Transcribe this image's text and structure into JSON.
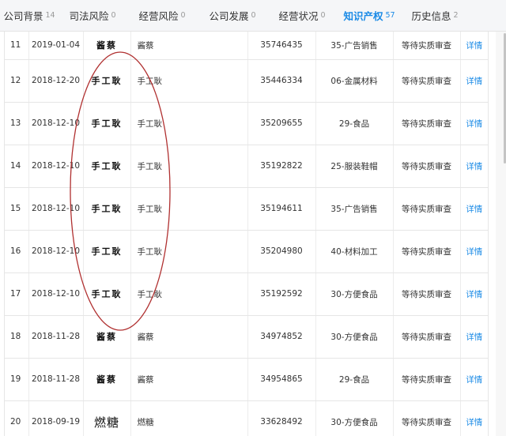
{
  "tabs": [
    {
      "label": "公司背景",
      "count": "14",
      "active": false,
      "w": 74
    },
    {
      "label": "司法风险",
      "count": "0",
      "active": false,
      "w": 86
    },
    {
      "label": "经营风险",
      "count": "0",
      "active": false,
      "w": 90
    },
    {
      "label": "公司发展",
      "count": "0",
      "active": false,
      "w": 88
    },
    {
      "label": "经营状况",
      "count": "0",
      "active": false,
      "w": 88
    },
    {
      "label": "知识产权",
      "count": "57",
      "active": true,
      "w": 82
    },
    {
      "label": "历史信息",
      "count": "2",
      "active": false,
      "w": 84
    }
  ],
  "rows": [
    {
      "no": "11",
      "date": "2019-01-04",
      "logo": "酱蔡",
      "name": "酱蔡",
      "reg": "35746435",
      "cls": "35-广告销售",
      "status": "等待实质审查",
      "detail": "详情"
    },
    {
      "no": "12",
      "date": "2018-12-20",
      "logo": "手工耿",
      "name": "手工耿",
      "reg": "35446334",
      "cls": "06-金属材料",
      "status": "等待实质审查",
      "detail": "详情"
    },
    {
      "no": "13",
      "date": "2018-12-10",
      "logo": "手工耿",
      "name": "手工耿",
      "reg": "35209655",
      "cls": "29-食品",
      "status": "等待实质审查",
      "detail": "详情"
    },
    {
      "no": "14",
      "date": "2018-12-10",
      "logo": "手工耿",
      "name": "手工耿",
      "reg": "35192822",
      "cls": "25-服装鞋帽",
      "status": "等待实质审查",
      "detail": "详情"
    },
    {
      "no": "15",
      "date": "2018-12-10",
      "logo": "手工耿",
      "name": "手工耿",
      "reg": "35194611",
      "cls": "35-广告销售",
      "status": "等待实质审查",
      "detail": "详情"
    },
    {
      "no": "16",
      "date": "2018-12-10",
      "logo": "手工耿",
      "name": "手工耿",
      "reg": "35204980",
      "cls": "40-材料加工",
      "status": "等待实质审查",
      "detail": "详情"
    },
    {
      "no": "17",
      "date": "2018-12-10",
      "logo": "手工耿",
      "name": "手工耿",
      "reg": "35192592",
      "cls": "30-方便食品",
      "status": "等待实质审查",
      "detail": "详情"
    },
    {
      "no": "18",
      "date": "2018-11-28",
      "logo": "酱蔡",
      "name": "酱蔡",
      "reg": "34974852",
      "cls": "30-方便食品",
      "status": "等待实质审查",
      "detail": "详情"
    },
    {
      "no": "19",
      "date": "2018-11-28",
      "logo": "酱蔡",
      "name": "酱蔡",
      "reg": "34954865",
      "cls": "29-食品",
      "status": "等待实质审查",
      "detail": "详情"
    },
    {
      "no": "20",
      "date": "2018-09-19",
      "logo": "燃糖",
      "name": "燃糖",
      "reg": "33628492",
      "cls": "30-方便食品",
      "status": "等待实质审查",
      "detail": "详情"
    }
  ],
  "colors": {
    "accent": "#1a8ae6",
    "annotation": "#b03030"
  }
}
